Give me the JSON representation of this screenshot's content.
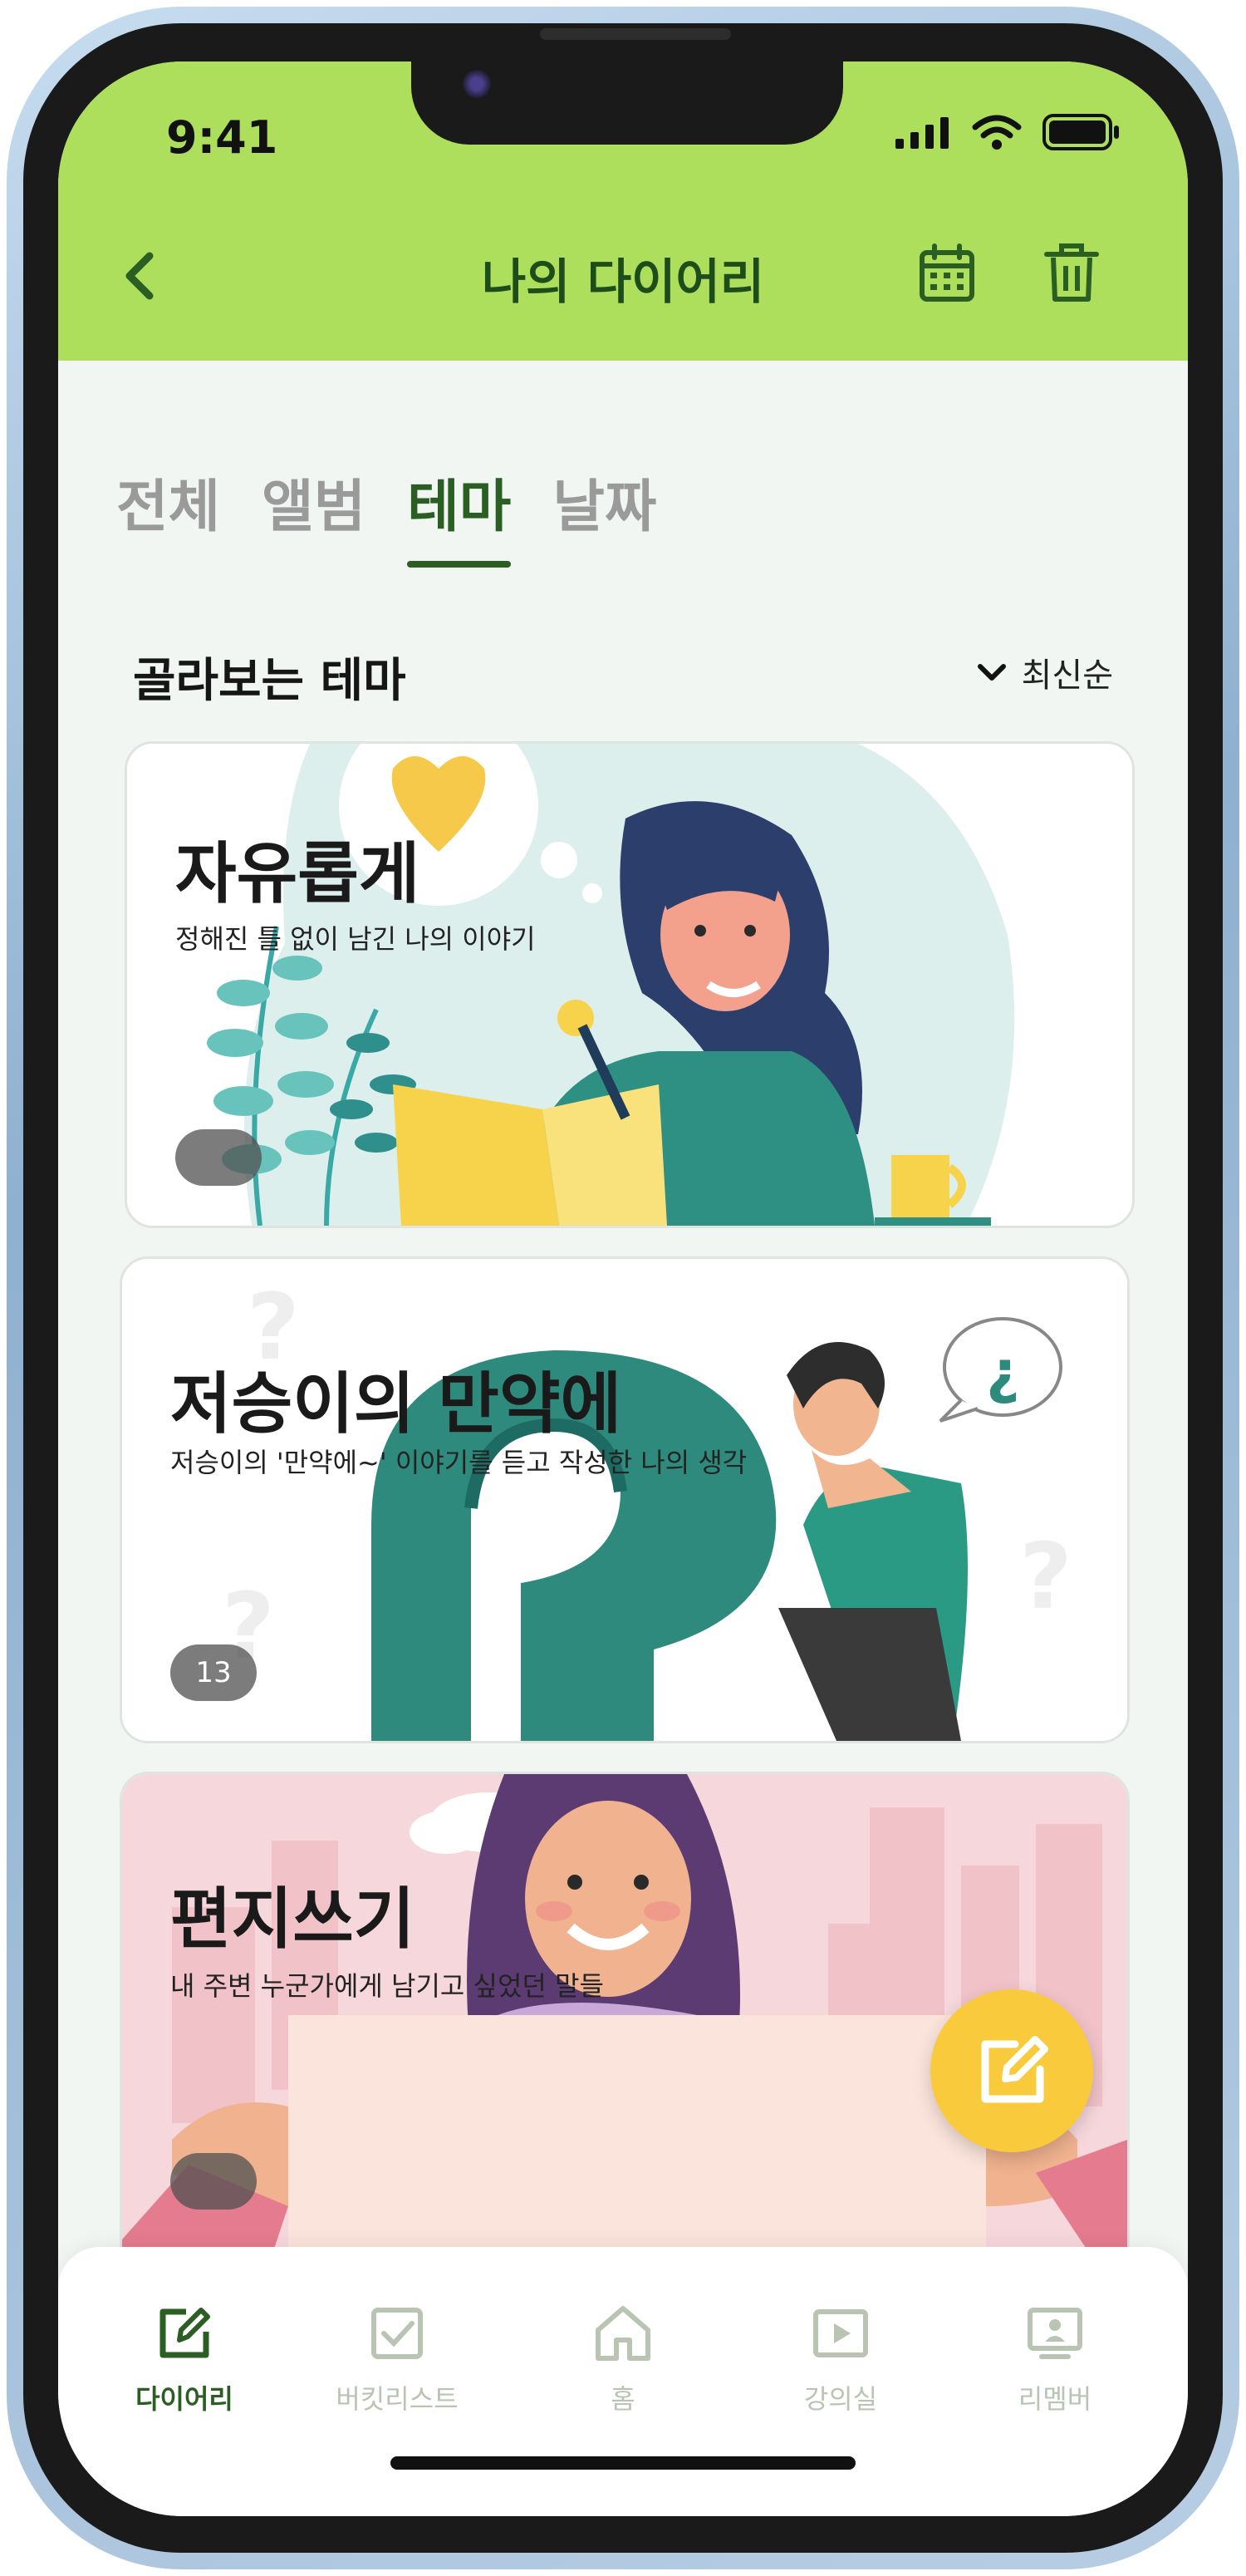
{
  "status": {
    "time": "9:41"
  },
  "header": {
    "title": "나의 다이어리"
  },
  "tabs": [
    {
      "label": "전체",
      "active": false
    },
    {
      "label": "앨범",
      "active": false
    },
    {
      "label": "테마",
      "active": true
    },
    {
      "label": "날짜",
      "active": false
    }
  ],
  "section": {
    "title": "골라보는 테마",
    "sort_label": "최신순"
  },
  "cards": [
    {
      "title": "자유롭게",
      "subtitle": "정해진 틀 없이 남긴 나의 이야기",
      "count": ""
    },
    {
      "title": "저승이의 만약에",
      "subtitle": "저승이의 '만약에~' 이야기를 듣고 작성한 나의 생각",
      "count": "13"
    },
    {
      "title": "편지쓰기",
      "subtitle": "내 주변 누군가에게 남기고 싶었던 말들",
      "count": ""
    }
  ],
  "bottom_nav": [
    {
      "label": "다이어리",
      "icon": "diary-edit-icon",
      "active": true
    },
    {
      "label": "버킷리스트",
      "icon": "checkbox-icon",
      "active": false
    },
    {
      "label": "홈",
      "icon": "home-icon",
      "active": false
    },
    {
      "label": "강의실",
      "icon": "play-icon",
      "active": false
    },
    {
      "label": "리멤버",
      "icon": "monitor-person-icon",
      "active": false
    }
  ],
  "colors": {
    "header_bg": "#addf5c",
    "accent": "#2a5e22",
    "fab": "#f9cb3c"
  }
}
